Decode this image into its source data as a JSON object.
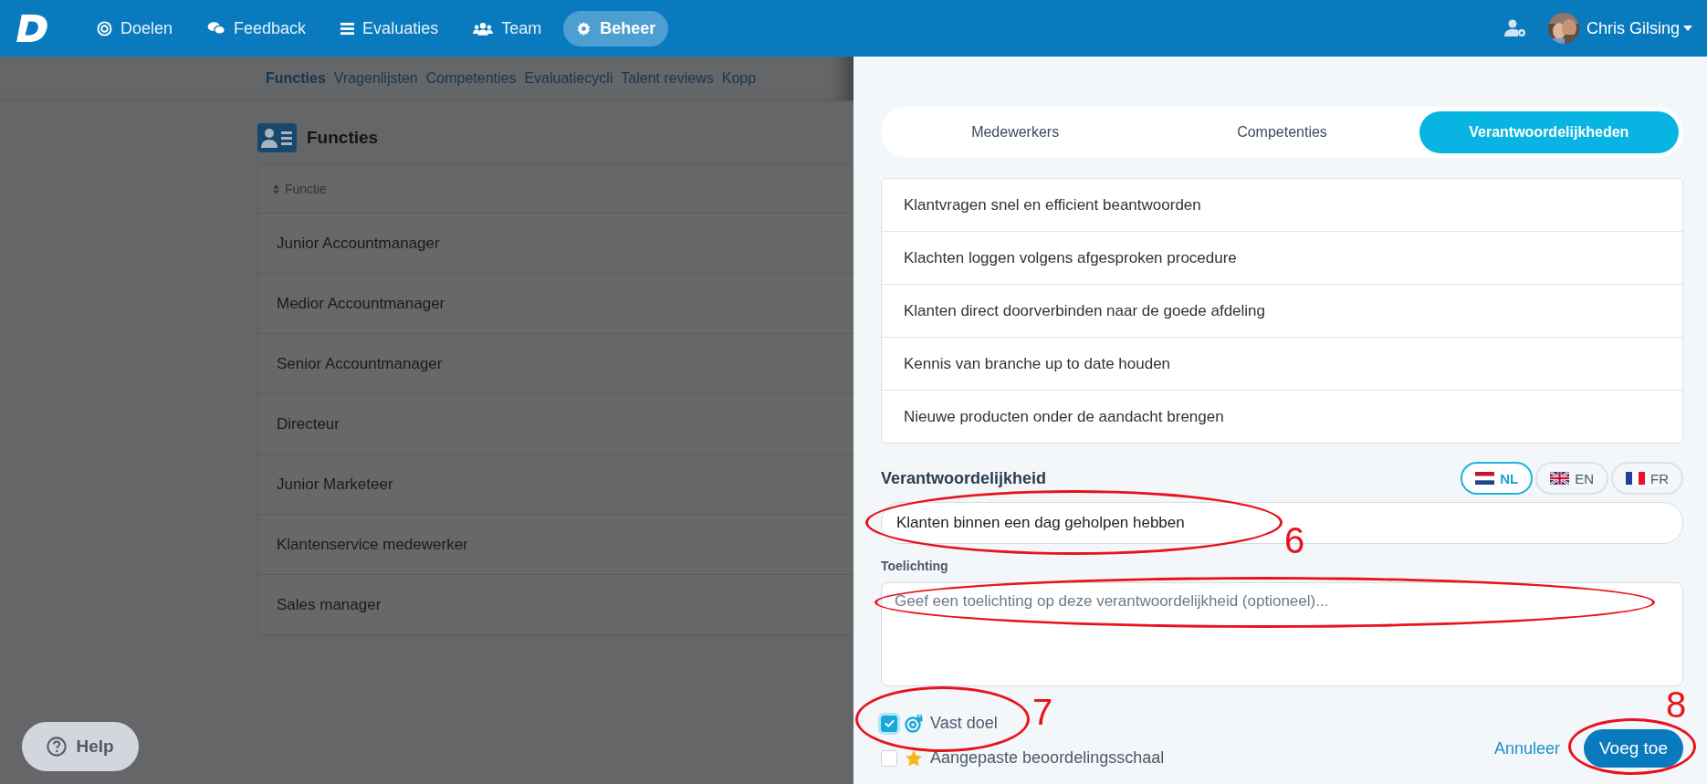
{
  "nav": {
    "items": [
      {
        "label": "Doelen",
        "selected": false
      },
      {
        "label": "Feedback",
        "selected": false
      },
      {
        "label": "Evaluaties",
        "selected": false
      },
      {
        "label": "Team",
        "selected": false
      },
      {
        "label": "Beheer",
        "selected": true
      }
    ],
    "user": {
      "name": "Chris Gilsing"
    }
  },
  "subnav": {
    "items": [
      {
        "label": "Functies",
        "selected": true
      },
      {
        "label": "Vragenlijsten",
        "selected": false
      },
      {
        "label": "Competenties",
        "selected": false
      },
      {
        "label": "Evaluatiecycli",
        "selected": false
      },
      {
        "label": "Talent reviews",
        "selected": false
      },
      {
        "label": "Kopp",
        "selected": false
      }
    ]
  },
  "page": {
    "title": "Functies",
    "table": {
      "columns": [
        "Functie"
      ],
      "rows": [
        "Junior Accountmanager",
        "Medior Accountmanager",
        "Senior Accountmanager",
        "Directeur",
        "Junior Marketeer",
        "Klantenservice medewerker",
        "Sales manager"
      ]
    }
  },
  "help": {
    "label": "Help"
  },
  "panel": {
    "tabs": [
      {
        "label": "Medewerkers",
        "selected": false
      },
      {
        "label": "Competenties",
        "selected": false
      },
      {
        "label": "Verantwoordelijkheden",
        "selected": true
      }
    ],
    "items": [
      "Klantvragen snel en efficient beantwoorden",
      "Klachten loggen volgens afgesproken procedure",
      "Klanten direct doorverbinden naar de goede afdeling",
      "Kennis van branche up to date houden",
      "Nieuwe producten onder de aandacht brengen"
    ],
    "form": {
      "label": "Verantwoordelijkheid",
      "languages": [
        {
          "code": "NL",
          "selected": true
        },
        {
          "code": "EN",
          "selected": false
        },
        {
          "code": "FR",
          "selected": false
        }
      ],
      "value": "Klanten binnen een dag geholpen hebben",
      "note_label": "Toelichting",
      "placeholder": "Geef een toelichting op deze verantwoordelijkheid (optioneel)...",
      "options": [
        {
          "label": "Vast doel",
          "checked": true
        },
        {
          "label": "Aangepaste beoordelingsschaal",
          "checked": false
        }
      ],
      "cancel": "Annuleer",
      "submit": "Voeg toe"
    }
  },
  "annotations": [
    {
      "number": "6"
    },
    {
      "number": "7"
    },
    {
      "number": "8"
    }
  ]
}
